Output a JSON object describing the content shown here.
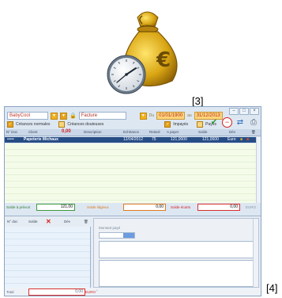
{
  "labels": {
    "ref1": "[3]",
    "ref2": "[4]"
  },
  "app": {
    "client_value": "BabyCool",
    "doc_type": "Facture",
    "date_from_label": "Du",
    "date_from": "01/01/1900",
    "date_to_label": "au",
    "date_to": "31/12/2013",
    "checks": {
      "normal": "Créances normales",
      "doubtful": "Créances douteuses",
      "unpaid": "Impayés",
      "paid": "Payés"
    },
    "columns": {
      "num": "N° Doc",
      "client": "Client",
      "amount_red": "0,00",
      "description": "Description",
      "echeance": "Echéance",
      "retard": "Retard",
      "apayer": "A payer",
      "solde": "Solde",
      "dev": "Dév"
    },
    "selected_row": {
      "num": "•••••",
      "client": "Papeterie Michaux",
      "date": "12/04/2012",
      "retard": "75",
      "apayer": "121,0000",
      "solde": "121,0000",
      "dev": "Euro"
    },
    "totals": {
      "prevu_label": "Solde à prévoir",
      "prevu_value": "121,00",
      "litige_label": "Solde litigieux",
      "litige_value": "0,00",
      "ecarts_label": "Solde écarts",
      "ecarts_value": "0,00",
      "currency": "EURO"
    },
    "bottom": {
      "col1": "N° doc",
      "col2": "Solde",
      "col3": "Dév",
      "montant_label": "Montant payé",
      "total_label": "Total",
      "total_value": "0,00",
      "total_currency": "EURO"
    }
  }
}
